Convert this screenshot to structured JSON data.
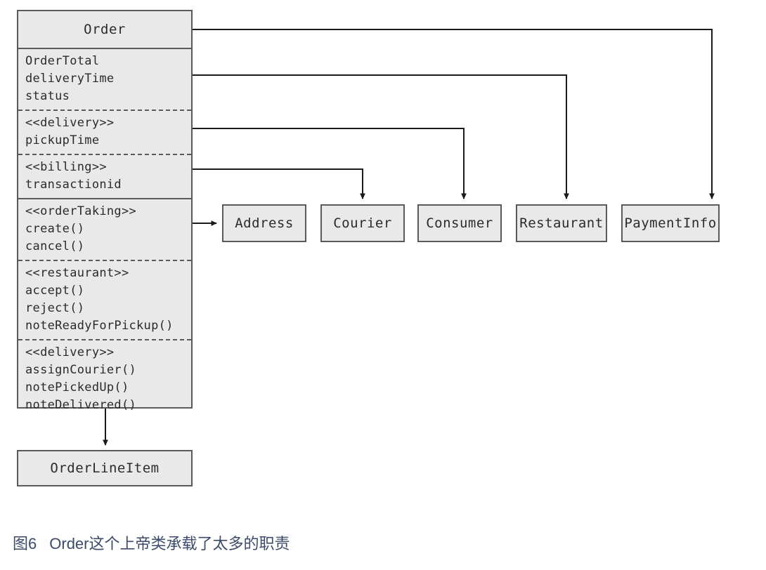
{
  "diagram": {
    "title_class": "Order",
    "caption_number": "图6",
    "caption_text": "Order这个上帝类承载了太多的职责",
    "caption_color": "#3c4a6b",
    "box_fill": "#e9e9e9",
    "box_border": "#5a5a5a",
    "line_color": "#1a1a1a"
  },
  "order_class": {
    "name": "Order",
    "attribute_compartments": [
      {
        "stereotype": null,
        "members": [
          "OrderTotal",
          "deliveryTime",
          "status"
        ]
      },
      {
        "stereotype": "<<delivery>>",
        "members": [
          "pickupTime"
        ]
      },
      {
        "stereotype": "<<billing>>",
        "members": [
          "transactionid"
        ]
      }
    ],
    "operation_compartments": [
      {
        "stereotype": "<<orderTaking>>",
        "members": [
          "create()",
          "cancel()"
        ]
      },
      {
        "stereotype": "<<restaurant>>",
        "members": [
          "accept()",
          "reject()",
          "noteReadyForPickup()"
        ]
      },
      {
        "stereotype": "<<delivery>>",
        "members": [
          "assignCourier()",
          "notePickedUp()",
          "noteDelivered()"
        ]
      }
    ]
  },
  "related_classes": [
    {
      "name": "Address"
    },
    {
      "name": "Courier"
    },
    {
      "name": "Consumer"
    },
    {
      "name": "Restaurant"
    },
    {
      "name": "PaymentInfo"
    },
    {
      "name": "OrderLineItem"
    }
  ]
}
